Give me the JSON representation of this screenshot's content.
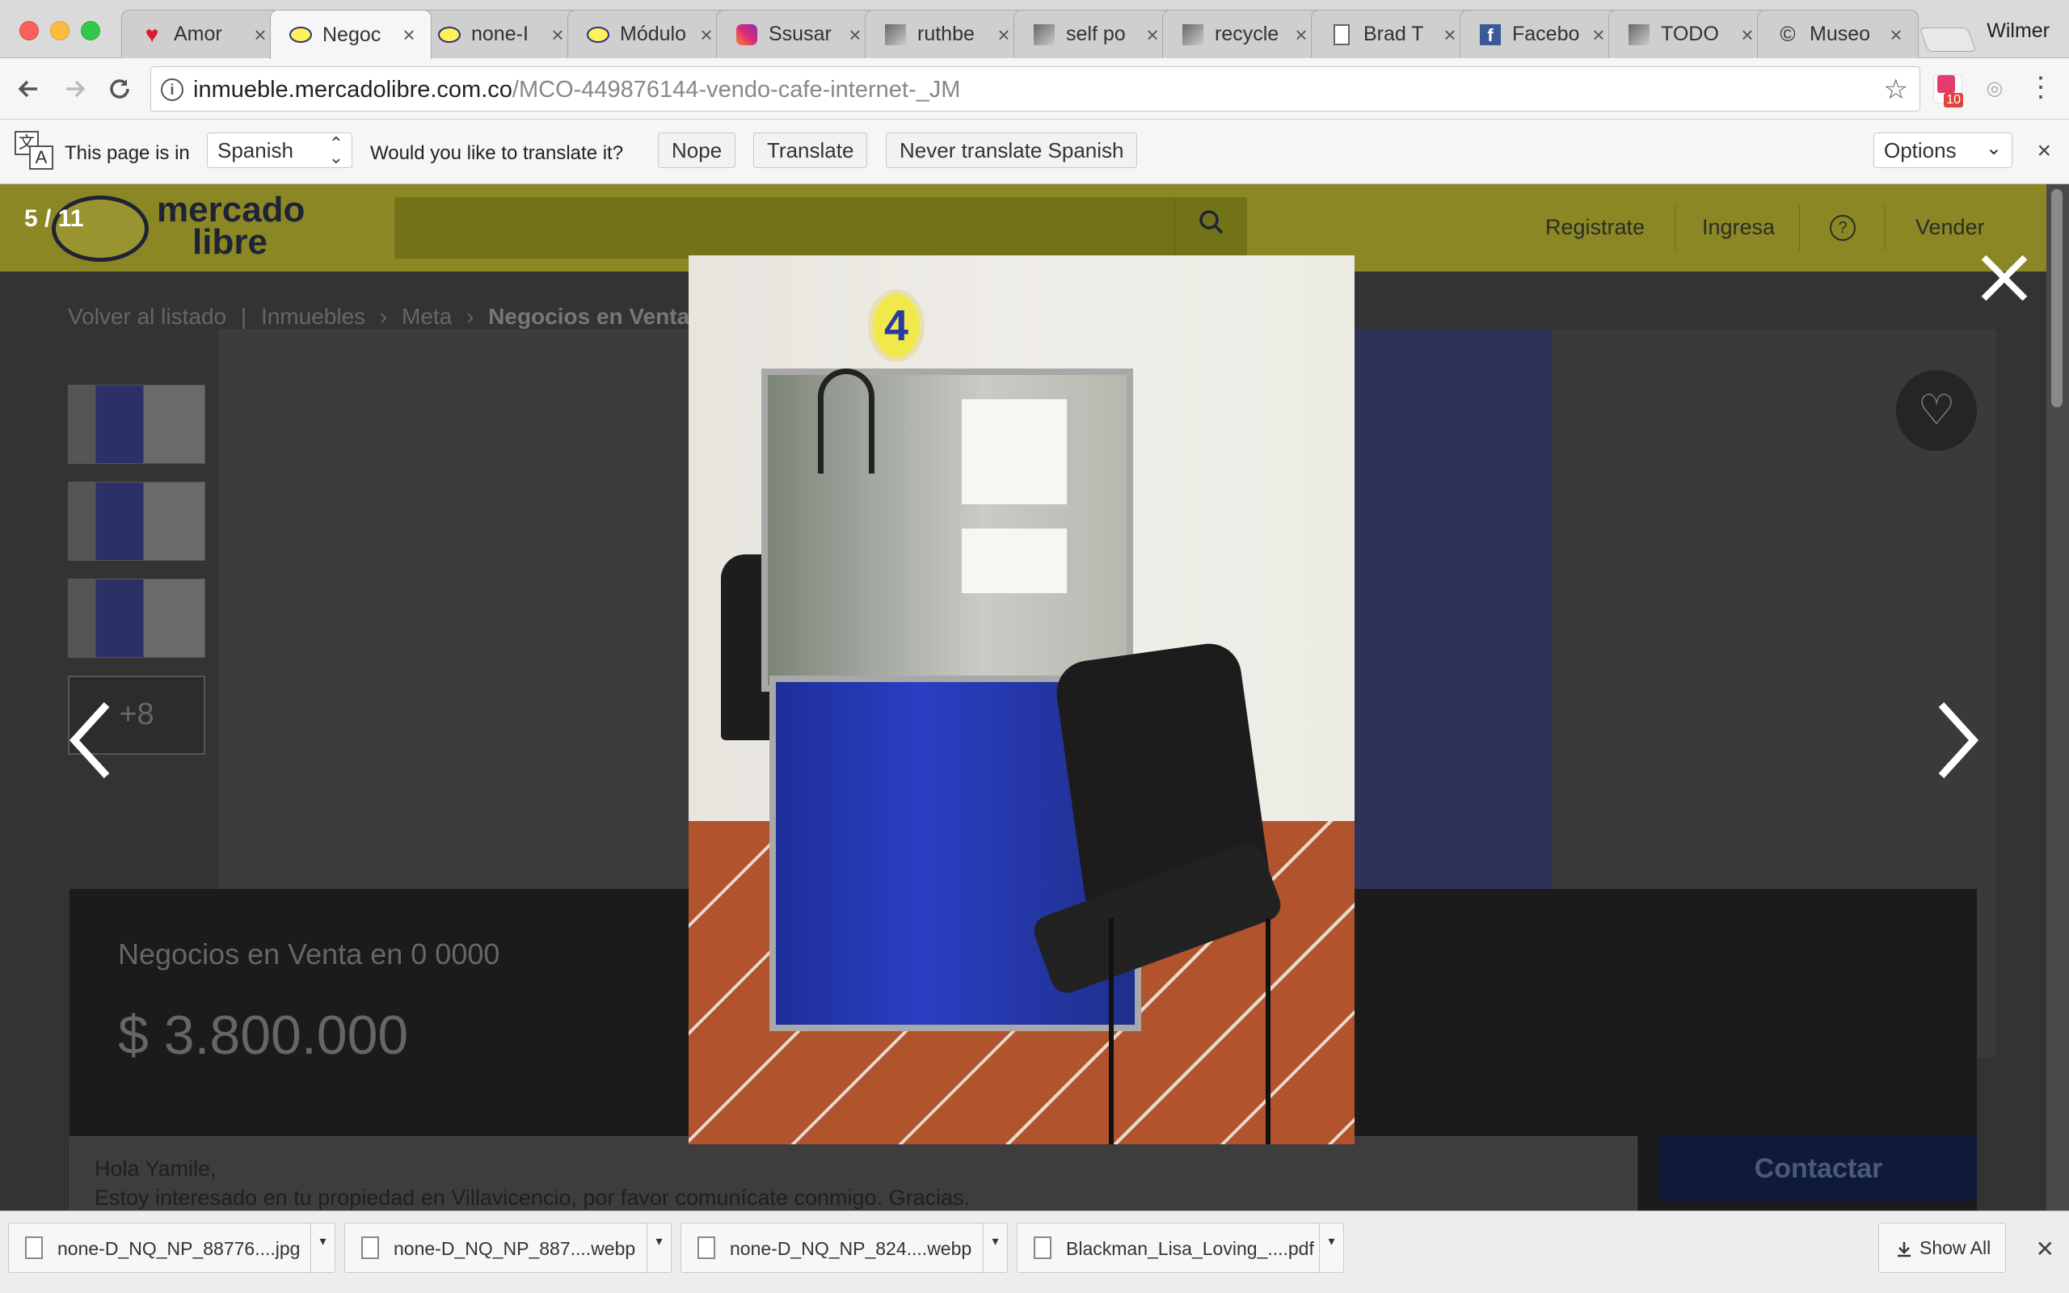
{
  "browser": {
    "profile_name": "Wilmer",
    "tabs": [
      {
        "title": "Amor",
        "icon": "heart-icon",
        "active": false
      },
      {
        "title": "Negoc",
        "icon": "mercadolibre-icon",
        "active": true
      },
      {
        "title": "none-I",
        "icon": "mercadolibre-icon",
        "active": false
      },
      {
        "title": "Módulo",
        "icon": "mercadolibre-icon",
        "active": false
      },
      {
        "title": "Ssusar",
        "icon": "instagram-icon",
        "active": false
      },
      {
        "title": "ruthbe",
        "icon": "photo-icon",
        "active": false
      },
      {
        "title": "self po",
        "icon": "photo-icon",
        "active": false
      },
      {
        "title": "recycle",
        "icon": "photo-icon",
        "active": false
      },
      {
        "title": "Brad T",
        "icon": "document-icon",
        "active": false
      },
      {
        "title": "Facebo",
        "icon": "facebook-icon",
        "active": false
      },
      {
        "title": "TODO",
        "icon": "photo-icon",
        "active": false
      },
      {
        "title": "Museo",
        "icon": "copyright-icon",
        "active": false
      }
    ],
    "tab_close_glyph": "×",
    "url_host": "inmueble.mercadolibre.com.co",
    "url_path": "/MCO-449876144-vendo-cafe-internet-_JM",
    "extension_badge": "10"
  },
  "translate_bar": {
    "prefix": "This page is in",
    "language": "Spanish",
    "question": "Would you like to translate it?",
    "nope": "Nope",
    "translate": "Translate",
    "never": "Never translate Spanish",
    "options": "Options"
  },
  "site": {
    "logo_line1": "mercado",
    "logo_line2": "libre",
    "nav": {
      "register": "Registrate",
      "login": "Ingresa",
      "help": "?",
      "sell": "Vender"
    },
    "breadcrumb": {
      "back": "Volver al listado",
      "sep1": "|",
      "cat1": "Inmuebles",
      "sep2": "›",
      "cat2": "Meta",
      "sep3": "›",
      "current": "Negocios en Venta er"
    },
    "more_photos": "+8",
    "listing_title": "Negocios en Venta en 0 0000",
    "price": "$ 3.800.000",
    "message_line1": "Hola Yamile,",
    "message_line2": "Estoy interesado en tu propiedad en Villavicencio, por favor comunícate conmigo. Gracias.",
    "contact_button": "Contactar"
  },
  "lightbox": {
    "counter": "5 / 11",
    "booth_number": "4"
  },
  "downloads": {
    "items": [
      {
        "name": "none-D_NQ_NP_88776....jpg"
      },
      {
        "name": "none-D_NQ_NP_887....webp"
      },
      {
        "name": "none-D_NQ_NP_824....webp"
      },
      {
        "name": "Blackman_Lisa_Loving_....pdf"
      }
    ],
    "show_all": "Show All"
  }
}
